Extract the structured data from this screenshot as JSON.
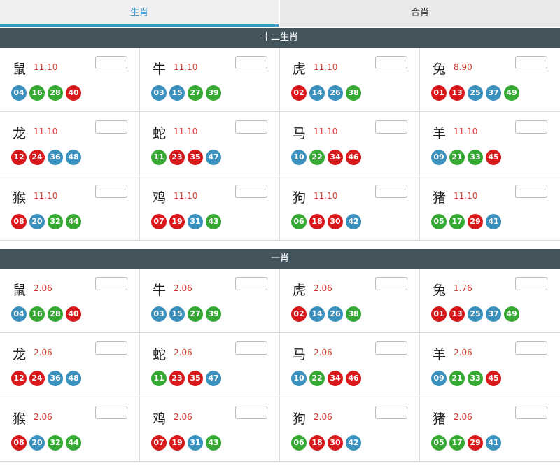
{
  "tabs": {
    "zodiac": "生肖",
    "combo": "合肖"
  },
  "colors": {
    "red": "#d7191c",
    "blue": "#3a91bd",
    "green": "#36a935",
    "header": "#44545c",
    "accent": "#3a97c9"
  },
  "sections": [
    {
      "title": "十二生肖",
      "items": [
        {
          "name": "鼠",
          "odds": "11.10",
          "balls": [
            {
              "n": "04",
              "c": "blue"
            },
            {
              "n": "16",
              "c": "green"
            },
            {
              "n": "28",
              "c": "green"
            },
            {
              "n": "40",
              "c": "red"
            }
          ]
        },
        {
          "name": "牛",
          "odds": "11.10",
          "balls": [
            {
              "n": "03",
              "c": "blue"
            },
            {
              "n": "15",
              "c": "blue"
            },
            {
              "n": "27",
              "c": "green"
            },
            {
              "n": "39",
              "c": "green"
            }
          ]
        },
        {
          "name": "虎",
          "odds": "11.10",
          "balls": [
            {
              "n": "02",
              "c": "red"
            },
            {
              "n": "14",
              "c": "blue"
            },
            {
              "n": "26",
              "c": "blue"
            },
            {
              "n": "38",
              "c": "green"
            }
          ]
        },
        {
          "name": "兔",
          "odds": "8.90",
          "balls": [
            {
              "n": "01",
              "c": "red"
            },
            {
              "n": "13",
              "c": "red"
            },
            {
              "n": "25",
              "c": "blue"
            },
            {
              "n": "37",
              "c": "blue"
            },
            {
              "n": "49",
              "c": "green"
            }
          ]
        },
        {
          "name": "龙",
          "odds": "11.10",
          "balls": [
            {
              "n": "12",
              "c": "red"
            },
            {
              "n": "24",
              "c": "red"
            },
            {
              "n": "36",
              "c": "blue"
            },
            {
              "n": "48",
              "c": "blue"
            }
          ]
        },
        {
          "name": "蛇",
          "odds": "11.10",
          "balls": [
            {
              "n": "11",
              "c": "green"
            },
            {
              "n": "23",
              "c": "red"
            },
            {
              "n": "35",
              "c": "red"
            },
            {
              "n": "47",
              "c": "blue"
            }
          ]
        },
        {
          "name": "马",
          "odds": "11.10",
          "balls": [
            {
              "n": "10",
              "c": "blue"
            },
            {
              "n": "22",
              "c": "green"
            },
            {
              "n": "34",
              "c": "red"
            },
            {
              "n": "46",
              "c": "red"
            }
          ]
        },
        {
          "name": "羊",
          "odds": "11.10",
          "balls": [
            {
              "n": "09",
              "c": "blue"
            },
            {
              "n": "21",
              "c": "green"
            },
            {
              "n": "33",
              "c": "green"
            },
            {
              "n": "45",
              "c": "red"
            }
          ]
        },
        {
          "name": "猴",
          "odds": "11.10",
          "balls": [
            {
              "n": "08",
              "c": "red"
            },
            {
              "n": "20",
              "c": "blue"
            },
            {
              "n": "32",
              "c": "green"
            },
            {
              "n": "44",
              "c": "green"
            }
          ]
        },
        {
          "name": "鸡",
          "odds": "11.10",
          "balls": [
            {
              "n": "07",
              "c": "red"
            },
            {
              "n": "19",
              "c": "red"
            },
            {
              "n": "31",
              "c": "blue"
            },
            {
              "n": "43",
              "c": "green"
            }
          ]
        },
        {
          "name": "狗",
          "odds": "11.10",
          "balls": [
            {
              "n": "06",
              "c": "green"
            },
            {
              "n": "18",
              "c": "red"
            },
            {
              "n": "30",
              "c": "red"
            },
            {
              "n": "42",
              "c": "blue"
            }
          ]
        },
        {
          "name": "猪",
          "odds": "11.10",
          "balls": [
            {
              "n": "05",
              "c": "green"
            },
            {
              "n": "17",
              "c": "green"
            },
            {
              "n": "29",
              "c": "red"
            },
            {
              "n": "41",
              "c": "blue"
            }
          ]
        }
      ]
    },
    {
      "title": "一肖",
      "items": [
        {
          "name": "鼠",
          "odds": "2.06",
          "balls": [
            {
              "n": "04",
              "c": "blue"
            },
            {
              "n": "16",
              "c": "green"
            },
            {
              "n": "28",
              "c": "green"
            },
            {
              "n": "40",
              "c": "red"
            }
          ]
        },
        {
          "name": "牛",
          "odds": "2.06",
          "balls": [
            {
              "n": "03",
              "c": "blue"
            },
            {
              "n": "15",
              "c": "blue"
            },
            {
              "n": "27",
              "c": "green"
            },
            {
              "n": "39",
              "c": "green"
            }
          ]
        },
        {
          "name": "虎",
          "odds": "2.06",
          "balls": [
            {
              "n": "02",
              "c": "red"
            },
            {
              "n": "14",
              "c": "blue"
            },
            {
              "n": "26",
              "c": "blue"
            },
            {
              "n": "38",
              "c": "green"
            }
          ]
        },
        {
          "name": "兔",
          "odds": "1.76",
          "balls": [
            {
              "n": "01",
              "c": "red"
            },
            {
              "n": "13",
              "c": "red"
            },
            {
              "n": "25",
              "c": "blue"
            },
            {
              "n": "37",
              "c": "blue"
            },
            {
              "n": "49",
              "c": "green"
            }
          ]
        },
        {
          "name": "龙",
          "odds": "2.06",
          "balls": [
            {
              "n": "12",
              "c": "red"
            },
            {
              "n": "24",
              "c": "red"
            },
            {
              "n": "36",
              "c": "blue"
            },
            {
              "n": "48",
              "c": "blue"
            }
          ]
        },
        {
          "name": "蛇",
          "odds": "2.06",
          "balls": [
            {
              "n": "11",
              "c": "green"
            },
            {
              "n": "23",
              "c": "red"
            },
            {
              "n": "35",
              "c": "red"
            },
            {
              "n": "47",
              "c": "blue"
            }
          ]
        },
        {
          "name": "马",
          "odds": "2.06",
          "balls": [
            {
              "n": "10",
              "c": "blue"
            },
            {
              "n": "22",
              "c": "green"
            },
            {
              "n": "34",
              "c": "red"
            },
            {
              "n": "46",
              "c": "red"
            }
          ]
        },
        {
          "name": "羊",
          "odds": "2.06",
          "balls": [
            {
              "n": "09",
              "c": "blue"
            },
            {
              "n": "21",
              "c": "green"
            },
            {
              "n": "33",
              "c": "green"
            },
            {
              "n": "45",
              "c": "red"
            }
          ]
        },
        {
          "name": "猴",
          "odds": "2.06",
          "balls": [
            {
              "n": "08",
              "c": "red"
            },
            {
              "n": "20",
              "c": "blue"
            },
            {
              "n": "32",
              "c": "green"
            },
            {
              "n": "44",
              "c": "green"
            }
          ]
        },
        {
          "name": "鸡",
          "odds": "2.06",
          "balls": [
            {
              "n": "07",
              "c": "red"
            },
            {
              "n": "19",
              "c": "red"
            },
            {
              "n": "31",
              "c": "blue"
            },
            {
              "n": "43",
              "c": "green"
            }
          ]
        },
        {
          "name": "狗",
          "odds": "2.06",
          "balls": [
            {
              "n": "06",
              "c": "green"
            },
            {
              "n": "18",
              "c": "red"
            },
            {
              "n": "30",
              "c": "red"
            },
            {
              "n": "42",
              "c": "blue"
            }
          ]
        },
        {
          "name": "猪",
          "odds": "2.06",
          "balls": [
            {
              "n": "05",
              "c": "green"
            },
            {
              "n": "17",
              "c": "green"
            },
            {
              "n": "29",
              "c": "red"
            },
            {
              "n": "41",
              "c": "blue"
            }
          ]
        }
      ]
    }
  ]
}
